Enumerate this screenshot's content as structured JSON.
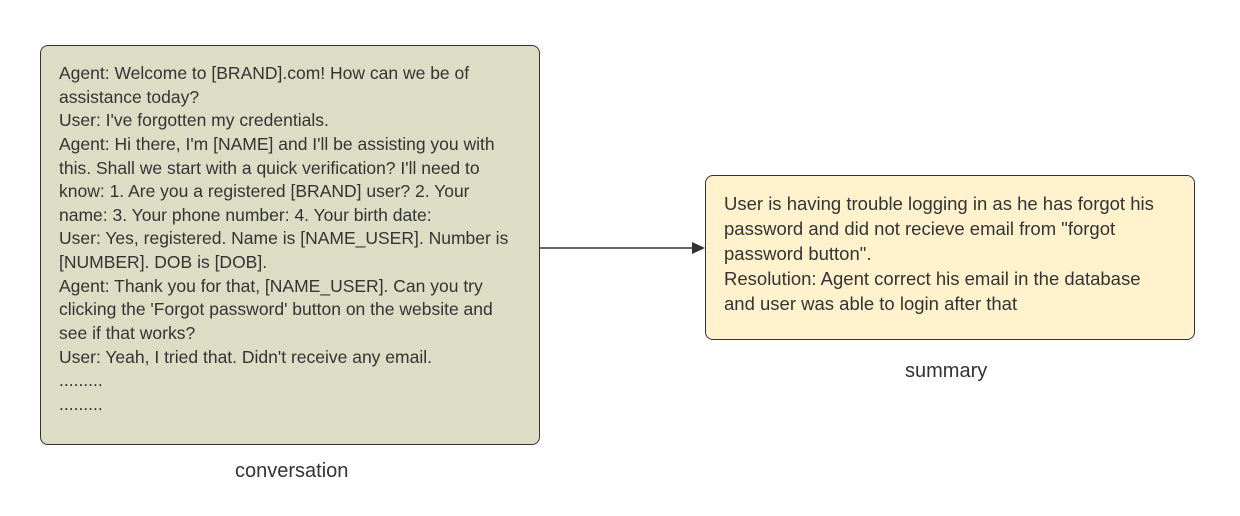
{
  "conversation": {
    "lines": [
      "Agent: Welcome to [BRAND].com! How can we be of assistance today?",
      "User: I've forgotten my credentials.",
      "Agent: Hi there, I'm [NAME] and I'll be assisting you with this. Shall we start with a quick verification? I'll need to know: 1. Are you a registered [BRAND] user? 2. Your name: 3. Your phone number: 4. Your birth date:",
      "User: Yes, registered. Name is [NAME_USER]. Number is [NUMBER]. DOB is [DOB].",
      "Agent: Thank you for that, [NAME_USER]. Can you try clicking the 'Forgot password' button on the website and see if that works?",
      "User: Yeah, I tried that. Didn't receive any email.",
      ".........",
      "........."
    ],
    "label": "conversation"
  },
  "summary": {
    "text": "User is having trouble logging in as he has forgot his password and did not recieve email from \"forgot password button\".\nResolution: Agent correct his email in the database and user was able to login after that",
    "label": "summary"
  },
  "colors": {
    "conversation_bg": "#ddddc6",
    "summary_bg": "#fff2cc",
    "border": "#333333"
  }
}
